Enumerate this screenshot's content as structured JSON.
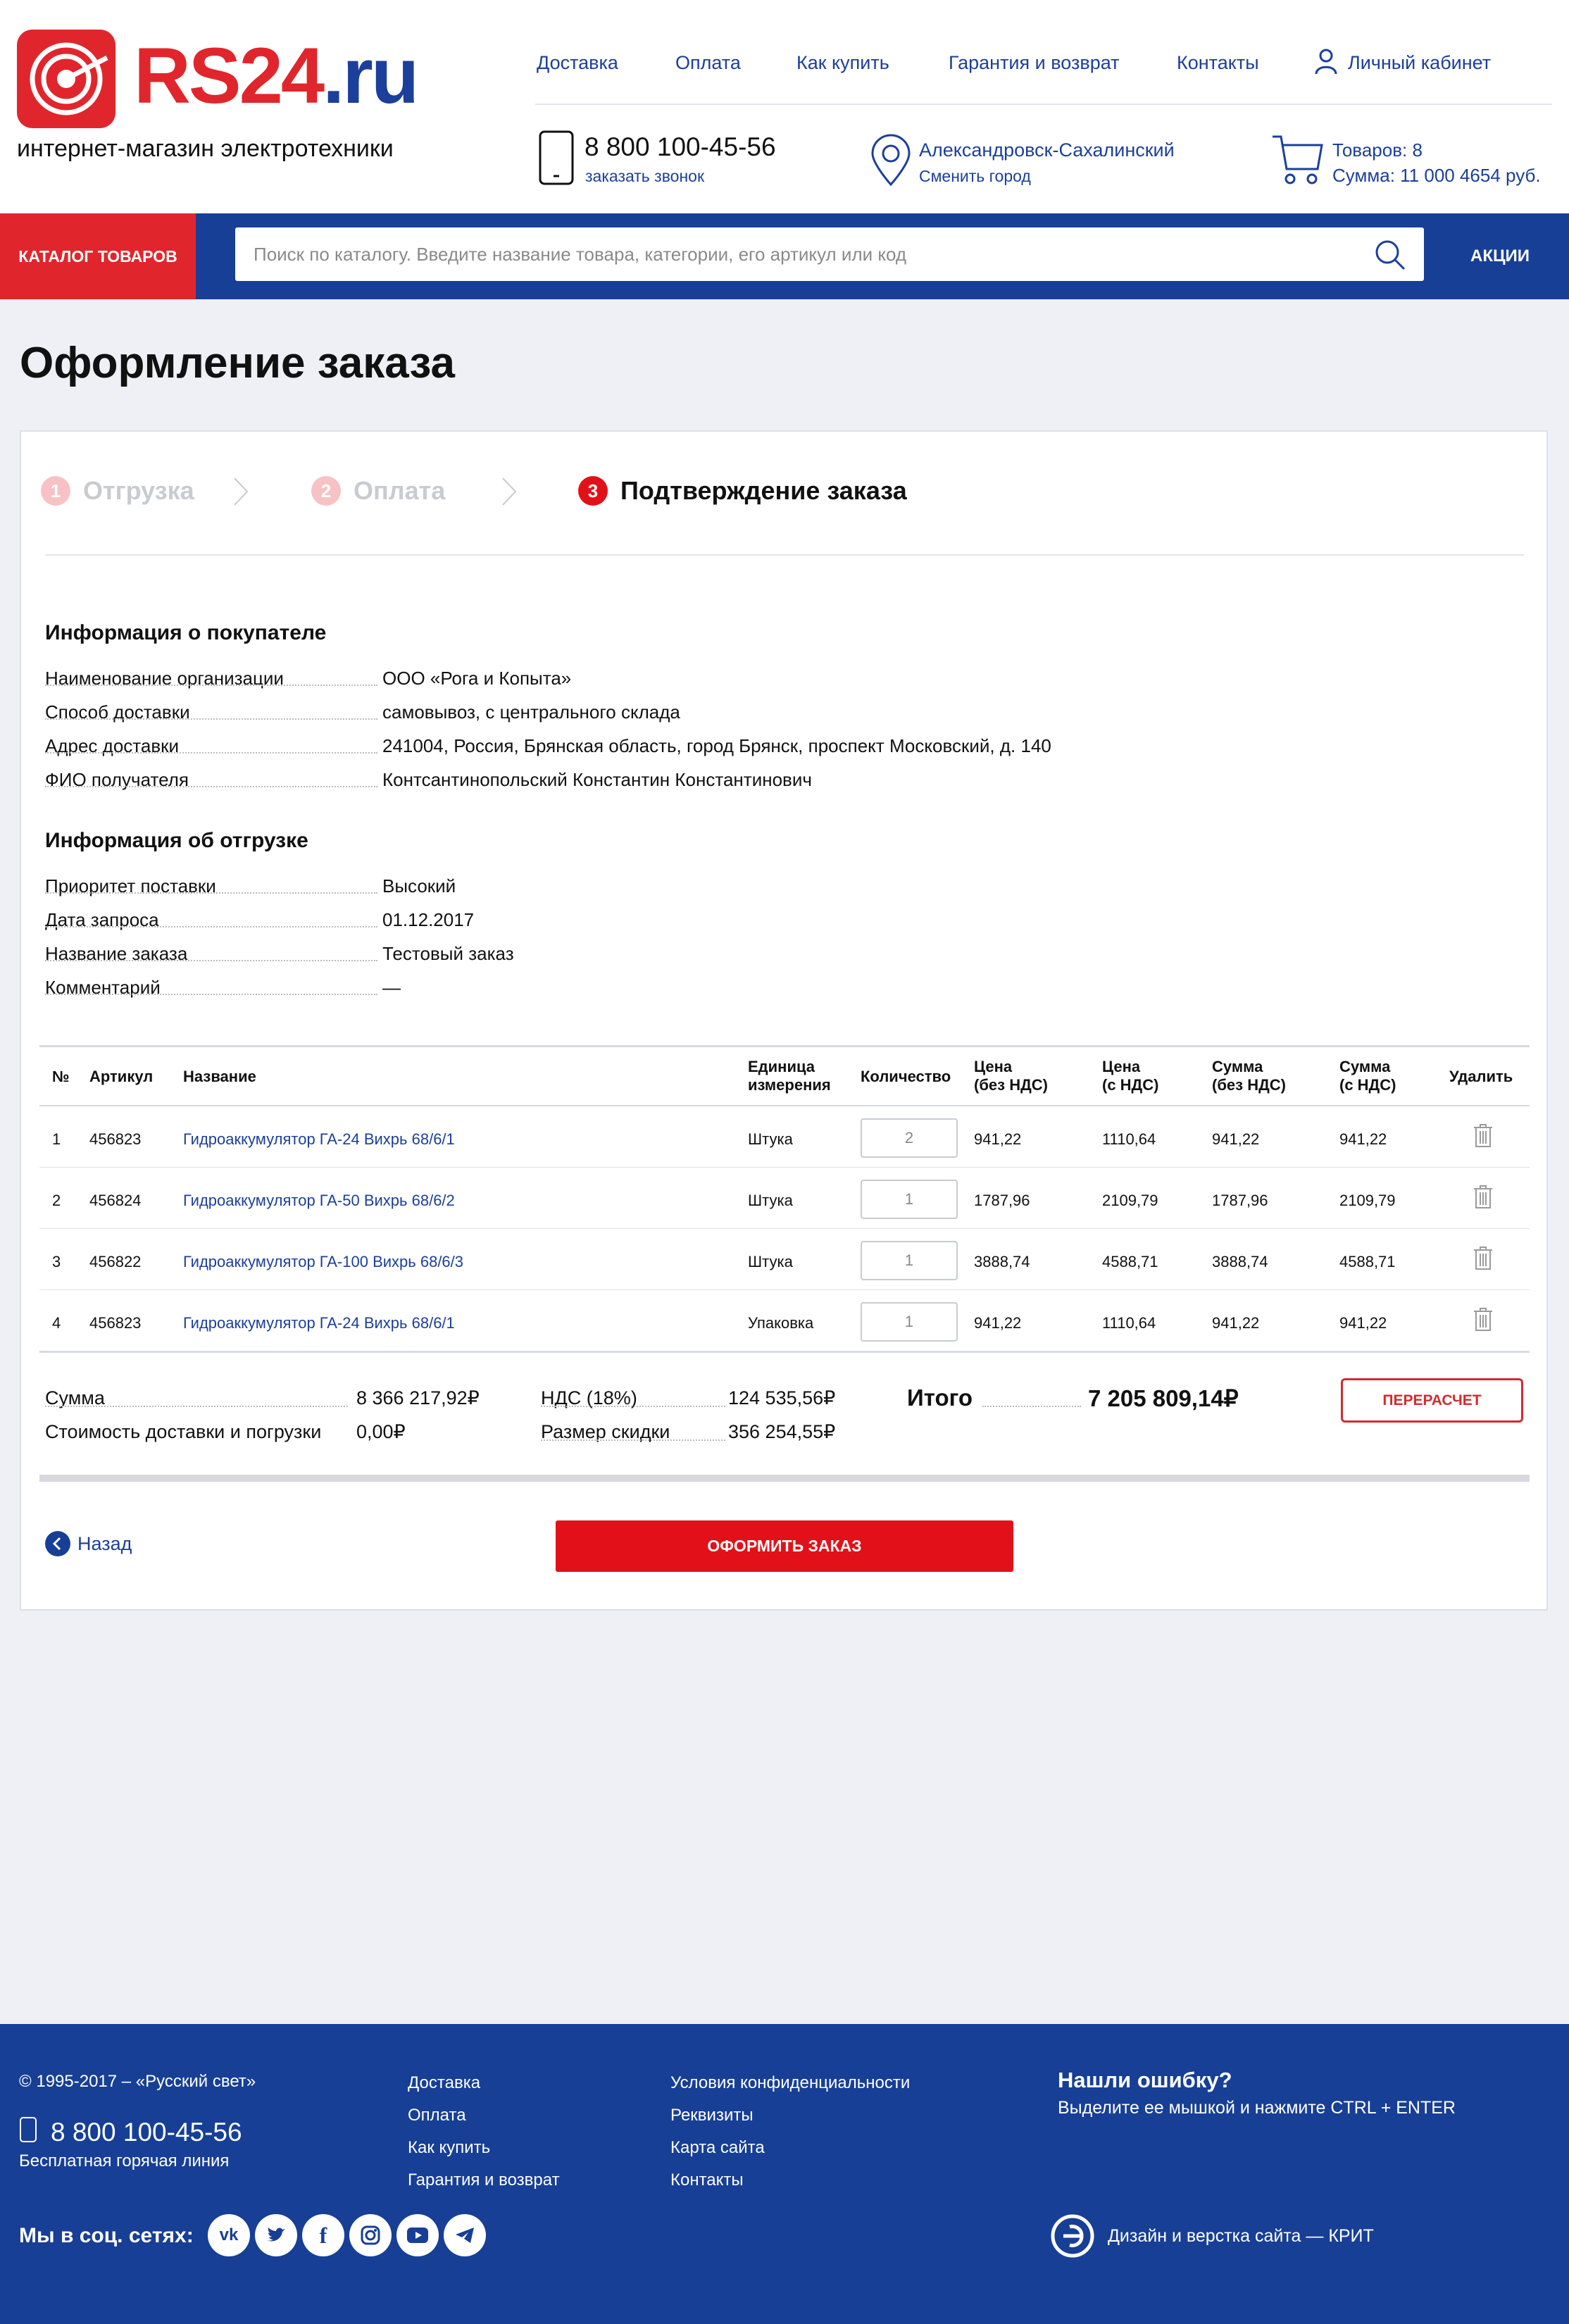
{
  "header": {
    "logo_main": "RS24",
    "logo_tld": ".ru",
    "tagline": "интернет-магазин электротехники",
    "nav": [
      "Доставка",
      "Оплата",
      "Как купить",
      "Гарантия и возврат",
      "Контакты"
    ],
    "account": "Личный кабинет",
    "phone": "8 800 100-45-56",
    "callback": "заказать звонок",
    "city": "Александровск-Сахалинский",
    "change_city": "Сменить город",
    "cart_count": "Товаров: 8",
    "cart_sum": "Сумма: 11 000 4654 руб."
  },
  "bar": {
    "catalog": "КАТАЛОГ ТОВАРОВ",
    "search_placeholder": "Поиск по каталогу. Введите название товара, категории, его артикул или код",
    "akcii": "АКЦИИ"
  },
  "page_title": "Оформление заказа",
  "steps": [
    {
      "num": "1",
      "label": "Отгрузка"
    },
    {
      "num": "2",
      "label": "Оплата"
    },
    {
      "num": "3",
      "label": "Подтверждение заказа"
    }
  ],
  "buyer": {
    "title": "Информация о покупателе",
    "rows": [
      {
        "label": "Наименование организации",
        "value": "ООО «Рога и Копыта»"
      },
      {
        "label": "Способ доставки",
        "value": "самовывоз, с центрального склада"
      },
      {
        "label": "Адрес доставки",
        "value": "241004, Россия, Брянская область, город Брянск, проспект Московский, д. 140"
      },
      {
        "label": "ФИО получателя",
        "value": "Контсантинопольский Константин Константинович"
      }
    ]
  },
  "shipment": {
    "title": "Информация об отгрузке",
    "rows": [
      {
        "label": "Приоритет поставки",
        "value": "Высокий"
      },
      {
        "label": "Дата запроса",
        "value": "01.12.2017"
      },
      {
        "label": "Название заказа",
        "value": "Тестовый заказ"
      },
      {
        "label": "Комментарий",
        "value": "—"
      }
    ]
  },
  "table": {
    "headers": {
      "num": "№",
      "article": "Артикул",
      "name": "Название",
      "unit": [
        "Единица",
        "измерения"
      ],
      "qty": "Количество",
      "price_no_vat": [
        "Цена",
        "(без НДС)"
      ],
      "price_vat": [
        "Цена",
        "(с НДС)"
      ],
      "sum_no_vat": [
        "Сумма",
        "(без НДС)"
      ],
      "sum_vat": [
        "Сумма",
        "(с НДС)"
      ],
      "delete": "Удалить"
    },
    "rows": [
      {
        "num": "1",
        "article": "456823",
        "name": "Гидроаккумулятор ГА-24 Вихрь 68/6/1",
        "unit": "Штука",
        "qty": "2",
        "price_no_vat": "941,22",
        "price_vat": "1110,64",
        "sum_no_vat": "941,22",
        "sum_vat": "941,22"
      },
      {
        "num": "2",
        "article": "456824",
        "name": "Гидроаккумулятор ГА-50 Вихрь 68/6/2",
        "unit": "Штука",
        "qty": "1",
        "price_no_vat": "1787,96",
        "price_vat": "2109,79",
        "sum_no_vat": "1787,96",
        "sum_vat": "2109,79"
      },
      {
        "num": "3",
        "article": "456822",
        "name": "Гидроаккумулятор ГА-100 Вихрь 68/6/3",
        "unit": "Штука",
        "qty": "1",
        "price_no_vat": "3888,74",
        "price_vat": "4588,71",
        "sum_no_vat": "3888,74",
        "sum_vat": "4588,71"
      },
      {
        "num": "4",
        "article": "456823",
        "name": "Гидроаккумулятор ГА-24 Вихрь 68/6/1",
        "unit": "Упаковка",
        "qty": "1",
        "price_no_vat": "941,22",
        "price_vat": "1110,64",
        "sum_no_vat": "941,22",
        "sum_vat": "941,22"
      }
    ]
  },
  "totals": {
    "sum_label": "Сумма",
    "sum_value": "8 366 217,92₽",
    "delivery_label": "Стоимость доставки и погрузки",
    "delivery_value": "0,00₽",
    "vat_label": "НДС (18%)",
    "vat_value": "124 535,56₽",
    "discount_label": "Размер скидки",
    "discount_value": "356 254,55₽",
    "total_label": "Итого",
    "total_value": "7 205 809,14₽",
    "recalc": "ПЕРЕРАСЧЕТ"
  },
  "actions": {
    "back": "Назад",
    "submit": "ОФОРМИТЬ ЗАКАЗ"
  },
  "footer": {
    "copyright": "© 1995-2017 – «Русский свет»",
    "phone": "8 800 100-45-56",
    "hotline": "Бесплатная горячая линия",
    "col1": [
      "Доставка",
      "Оплата",
      "Как купить",
      "Гарантия и возврат"
    ],
    "col2": [
      "Условия конфиденциальности",
      "Реквизиты",
      "Карта сайта",
      "Контакты"
    ],
    "error_title": "Нашли ошибку?",
    "error_text": "Выделите ее мышкой и нажмите CTRL + ENTER",
    "social_label": "Мы в соц. сетях:",
    "social": [
      "vk-icon",
      "twitter-icon",
      "facebook-icon",
      "instagram-icon",
      "youtube-icon",
      "telegram-icon"
    ],
    "design": "Дизайн и верстка сайта — КРИТ"
  },
  "colors": {
    "brand_red": "#e0262c",
    "brand_blue": "#173f96",
    "link_blue": "#1c3f9b"
  }
}
